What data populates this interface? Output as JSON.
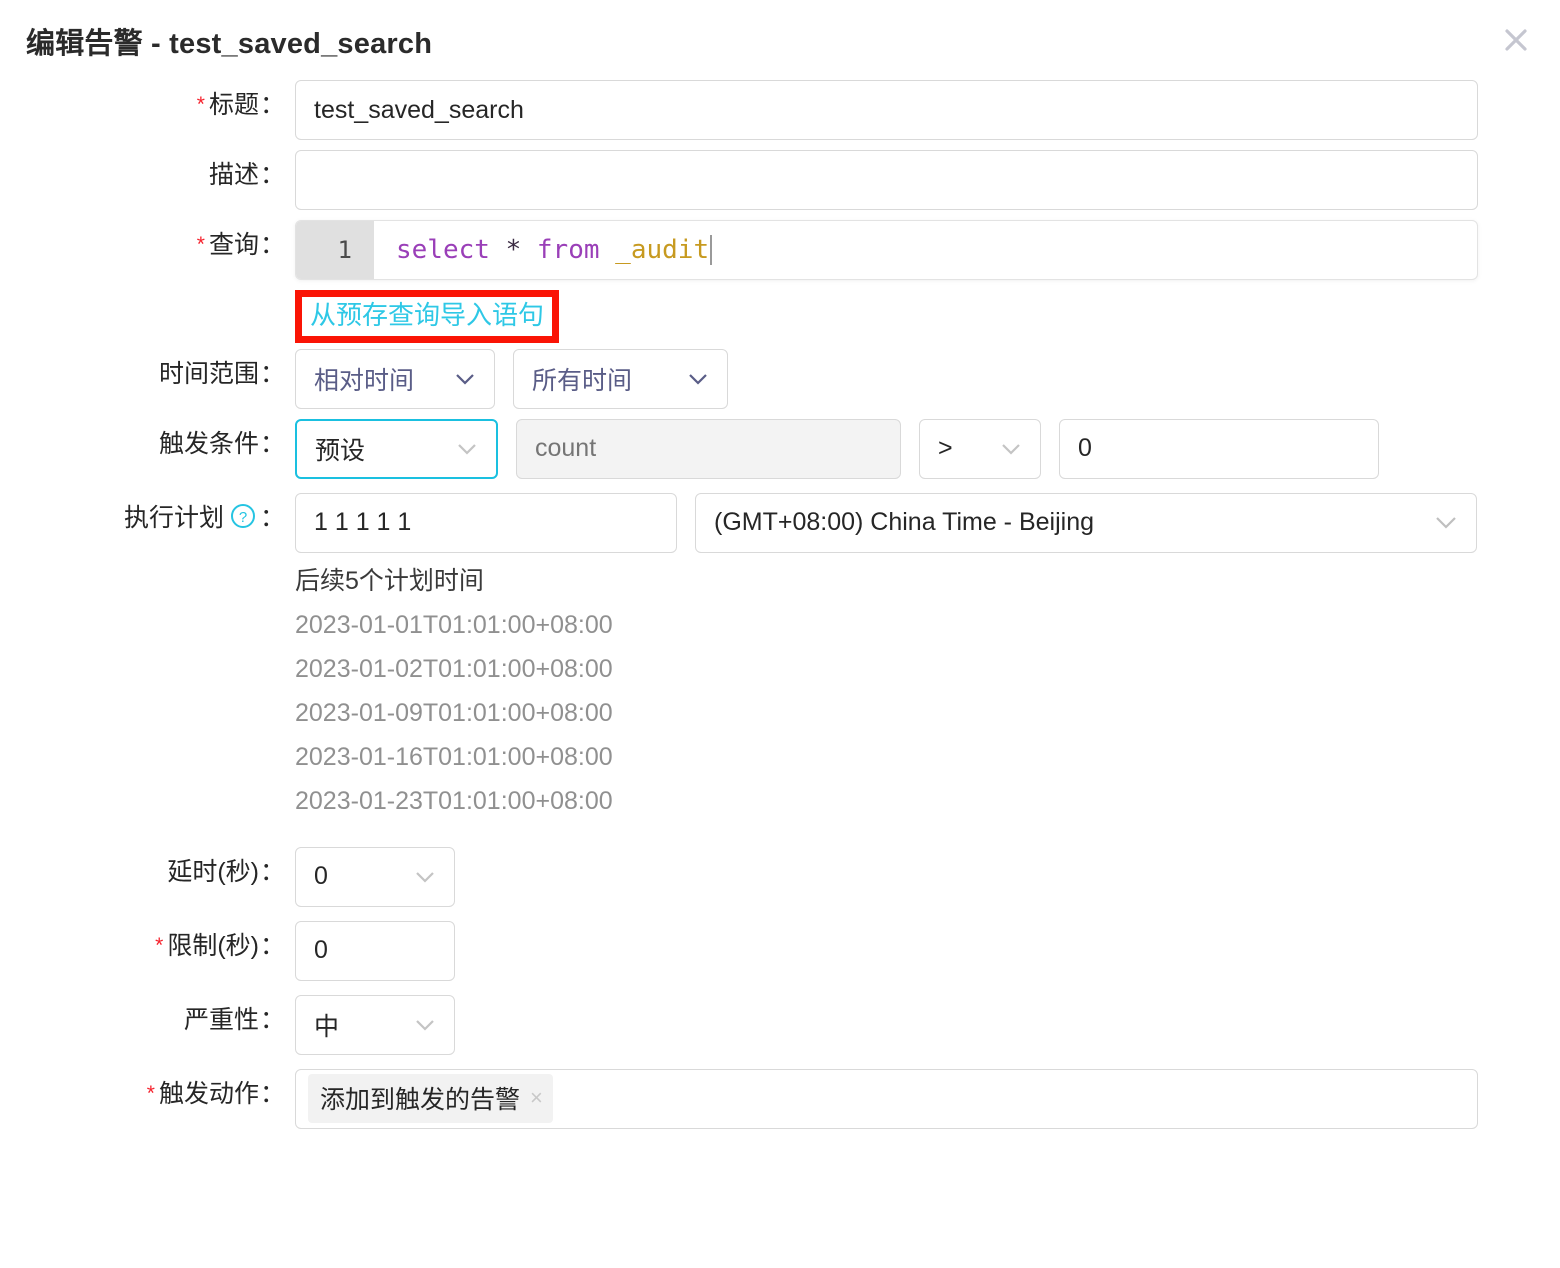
{
  "dialog": {
    "title": "编辑告警 - test_saved_search",
    "close_icon": "close-icon"
  },
  "form": {
    "title_field": {
      "label": "标题",
      "required": true,
      "value": "test_saved_search"
    },
    "description_field": {
      "label": "描述",
      "required": false,
      "value": ""
    },
    "query_field": {
      "label": "查询",
      "required": true,
      "line_number": "1",
      "tokens": [
        {
          "text": "select",
          "type": "keyword"
        },
        {
          "text": " ",
          "type": "plain"
        },
        {
          "text": "*",
          "type": "operator"
        },
        {
          "text": " ",
          "type": "plain"
        },
        {
          "text": "from",
          "type": "keyword"
        },
        {
          "text": " ",
          "type": "plain"
        },
        {
          "text": "_audit",
          "type": "table"
        }
      ],
      "raw": "select * from _audit",
      "import_link": "从预存查询导入语句",
      "link_highlight_color": "#fa1405",
      "link_color": "#2ec8e6"
    },
    "time_range": {
      "label": "时间范围",
      "required": false,
      "mode_value": "相对时间",
      "range_value": "所有时间"
    },
    "trigger_condition": {
      "label": "触发条件",
      "required": false,
      "preset_value": "预设",
      "preset_focused": true,
      "focus_color": "#1ac0e0",
      "metric_placeholder": "count",
      "metric_value": "",
      "metric_disabled": true,
      "operator_value": ">",
      "threshold_value": "0"
    },
    "schedule": {
      "label": "执行计划",
      "required": false,
      "help_icon": "question-circle-icon",
      "cron_value": "1 1 1 1 1",
      "timezone_value": "(GMT+08:00) China Time - Beijing",
      "next_title": "后续5个计划时间",
      "next_times": [
        "2023-01-01T01:01:00+08:00",
        "2023-01-02T01:01:00+08:00",
        "2023-01-09T01:01:00+08:00",
        "2023-01-16T01:01:00+08:00",
        "2023-01-23T01:01:00+08:00"
      ]
    },
    "delay_field": {
      "label": "延时(秒)",
      "required": false,
      "value": "0"
    },
    "limit_field": {
      "label": "限制(秒)",
      "required": true,
      "value": "0"
    },
    "severity_field": {
      "label": "严重性",
      "required": false,
      "value": "中"
    },
    "trigger_action": {
      "label": "触发动作",
      "required": true,
      "tags": [
        "添加到触发的告警"
      ],
      "tag_remove_icon": "×"
    }
  }
}
